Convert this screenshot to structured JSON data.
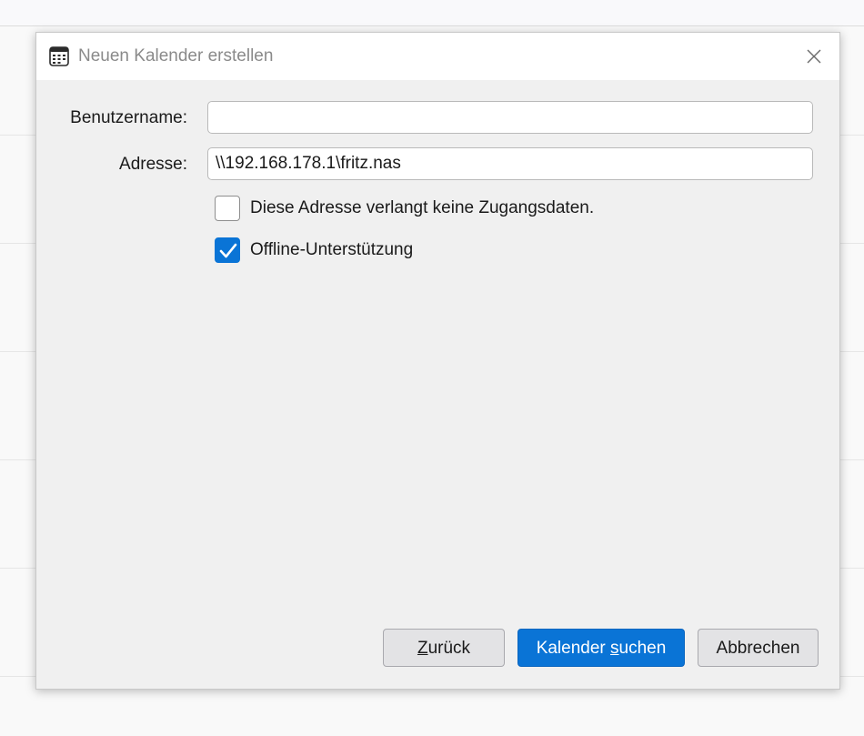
{
  "dialog": {
    "title": "Neuen Kalender erstellen",
    "icon": "calendar-icon",
    "close_icon": "close-icon"
  },
  "form": {
    "username_label": "Benutzername:",
    "username_value": "",
    "address_label": "Adresse:",
    "address_value": "\\\\192.168.178.1\\fritz.nas",
    "no_credentials_label": "Diese Adresse verlangt keine Zugangsdaten.",
    "no_credentials_checked": false,
    "offline_label": "Offline-Unterstützung",
    "offline_checked": true
  },
  "buttons": {
    "back": {
      "prefix": "",
      "accel": "Z",
      "suffix": "urück"
    },
    "search": {
      "prefix": "Kalender ",
      "accel": "s",
      "suffix": "uchen"
    },
    "cancel": {
      "label": "Abbrechen"
    }
  },
  "colors": {
    "accent": "#0a74d6",
    "dialog_bg": "#f0f0f0"
  }
}
